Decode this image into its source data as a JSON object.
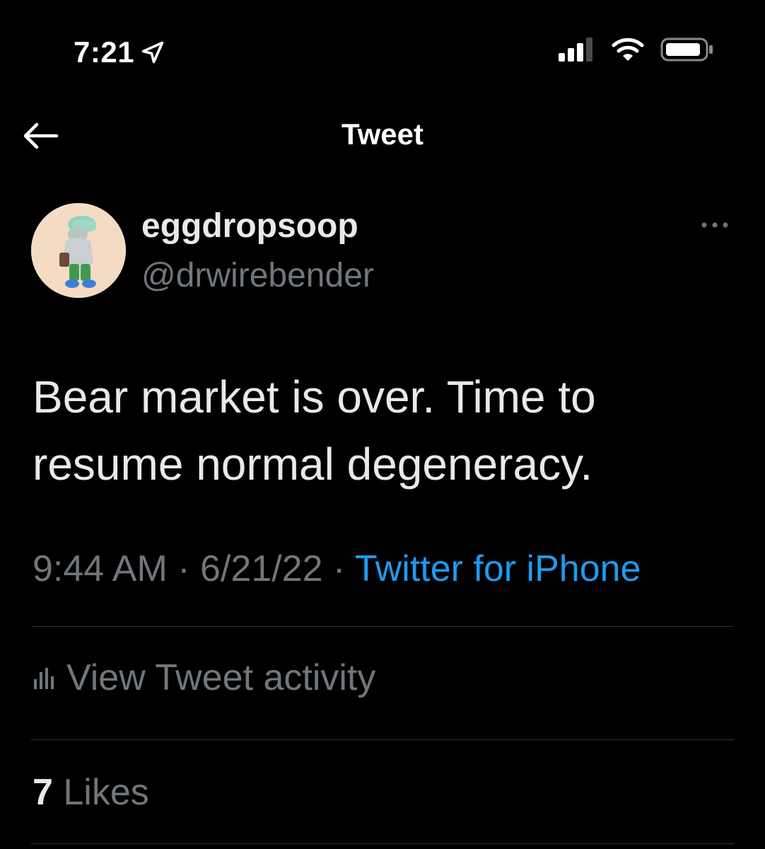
{
  "status_bar": {
    "time": "7:21",
    "icons": [
      "location-arrow-icon",
      "signal-icon",
      "wifi-icon",
      "battery-icon"
    ]
  },
  "nav": {
    "title": "Tweet",
    "back_icon": "back-arrow-icon"
  },
  "author": {
    "display_name": "eggdropsoop",
    "handle": "@drwirebender",
    "avatar_icon": "cartoon-avatar"
  },
  "tweet": {
    "text": "Bear market is over. Time to resume normal degeneracy.",
    "time": "9:44 AM",
    "date": "6/21/22",
    "separator": "·",
    "source": "Twitter for iPhone"
  },
  "activity": {
    "label": "View Tweet activity",
    "icon": "bar-chart-icon"
  },
  "stats": {
    "likes_count": "7",
    "likes_label": "Likes"
  },
  "colors": {
    "background": "#000000",
    "text": "#e7e9ea",
    "secondary": "#71767b",
    "link": "#1d9bf0",
    "divider": "#2f3336"
  }
}
